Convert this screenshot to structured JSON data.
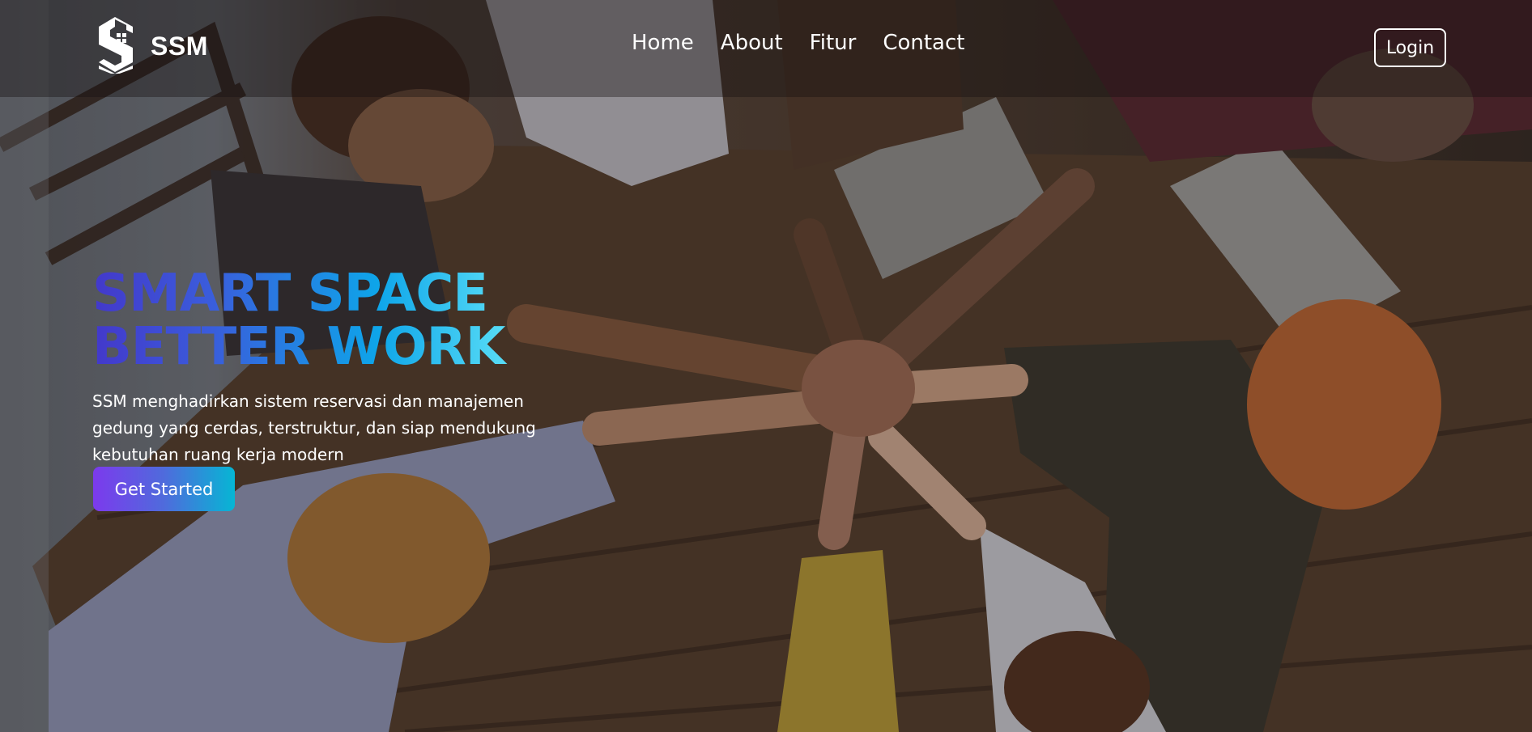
{
  "navbar": {
    "brand_name": "SSM",
    "logo_icon": "ssm-building-logo-icon",
    "links": [
      {
        "label": "Home"
      },
      {
        "label": "About"
      },
      {
        "label": "Fitur"
      },
      {
        "label": "Contact"
      }
    ],
    "login_label": "Login"
  },
  "hero": {
    "title_line1": "SMART SPACE",
    "title_line2": "BETTER WORK",
    "description": "SSM menghadirkan sistem reservasi dan manajemen gedung yang cerdas, terstruktur, dan siap mendukung kebutuhan ruang kerja modern",
    "cta_label": "Get Started",
    "background_image": "team-hands-together-photo"
  },
  "colors": {
    "title_gradient": [
      "#4338ca",
      "#0ea5e9",
      "#67e8f9"
    ],
    "cta_gradient": [
      "#7c3aed",
      "#06b6d4"
    ],
    "text": "#ffffff"
  }
}
